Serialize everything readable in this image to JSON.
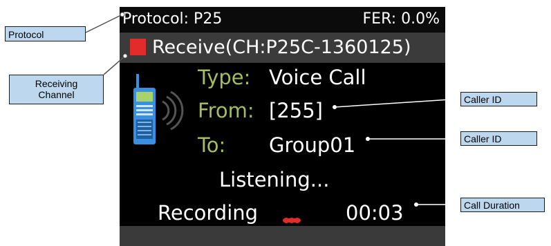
{
  "screen": {
    "protocol": "Protocol: P25",
    "fer": "FER: 0.0%",
    "receive": "Receive(CH:P25C-1360125)",
    "type_label": "Type:",
    "type_value": "Voice Call",
    "from_label": "From:",
    "from_value": "[255]",
    "to_label": "To:",
    "to_value": "Group01",
    "listening": "Listening...",
    "recording": "Recording",
    "duration": "00:03",
    "icon": "radio-icon"
  },
  "callouts": {
    "protocol": "Protocol",
    "receiving_channel": "Receiving Channel",
    "caller_id_from": "Caller ID",
    "caller_id_to": "Caller ID",
    "call_duration": "Call Duration"
  },
  "colors": {
    "label_green": "#a6bd5f",
    "recording_red": "#e32b2b",
    "callout_fill": "#bcd7ee",
    "radio_blue": "#3a8fe0"
  }
}
